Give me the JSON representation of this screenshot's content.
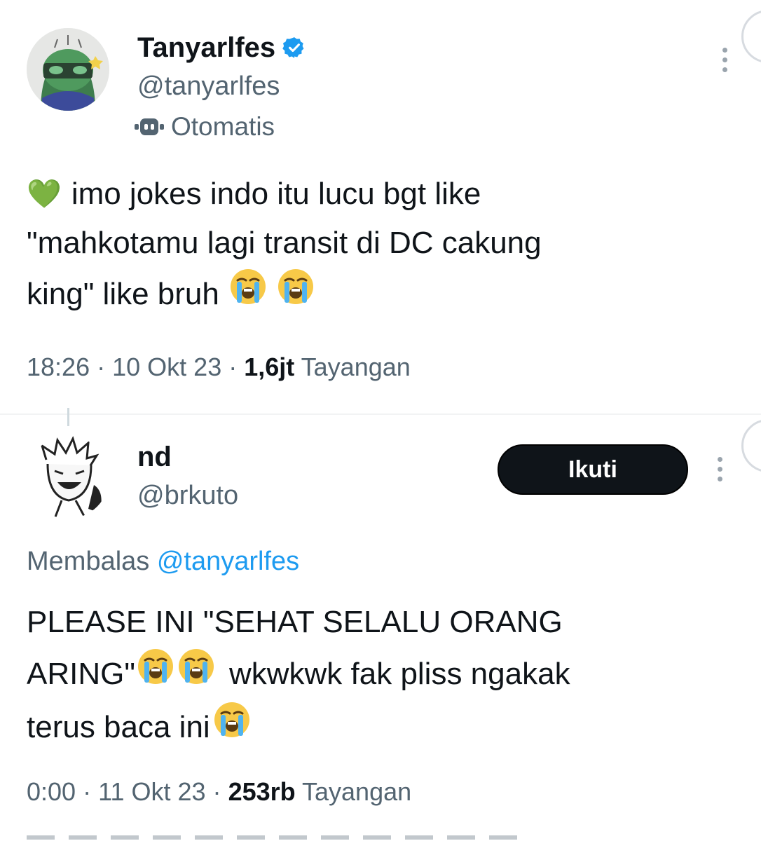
{
  "tweet": {
    "name": "Tanyarlfes",
    "handle": "@tanyarlfes",
    "automated_label": "Otomatis",
    "heart_emoji": "💚",
    "text_line1": "imo jokes indo itu lucu bgt like",
    "text_line2": "\"mahkotamu lagi transit di DC cakung",
    "text_line3": "king\" like bruh",
    "time": "18:26",
    "date": "10 Okt 23",
    "views": "1,6jt",
    "views_label": "Tayangan",
    "separator": "·"
  },
  "reply": {
    "name": "nd",
    "handle": "@brkuto",
    "follow_label": "Ikuti",
    "replying_prefix": "Membalas",
    "replying_to": "@tanyarlfes",
    "text_line1": "PLEASE INI \"SEHAT SELALU ORANG",
    "text_line2a": "ARING\"",
    "text_line2b": "wkwkwk fak pliss ngakak",
    "text_line3": "terus baca ini",
    "time": "0:00",
    "date": "11 Okt 23",
    "views": "253rb",
    "views_label": "Tayangan",
    "separator": "·"
  },
  "icons": {
    "verified": "verified-badge-icon",
    "bot": "bot-icon",
    "more": "more-options-icon",
    "crying": "loudly-crying-face-emoji"
  },
  "colors": {
    "text": "#0f1419",
    "muted": "#536471",
    "link": "#1d9bf0",
    "button": "#0f1419"
  }
}
